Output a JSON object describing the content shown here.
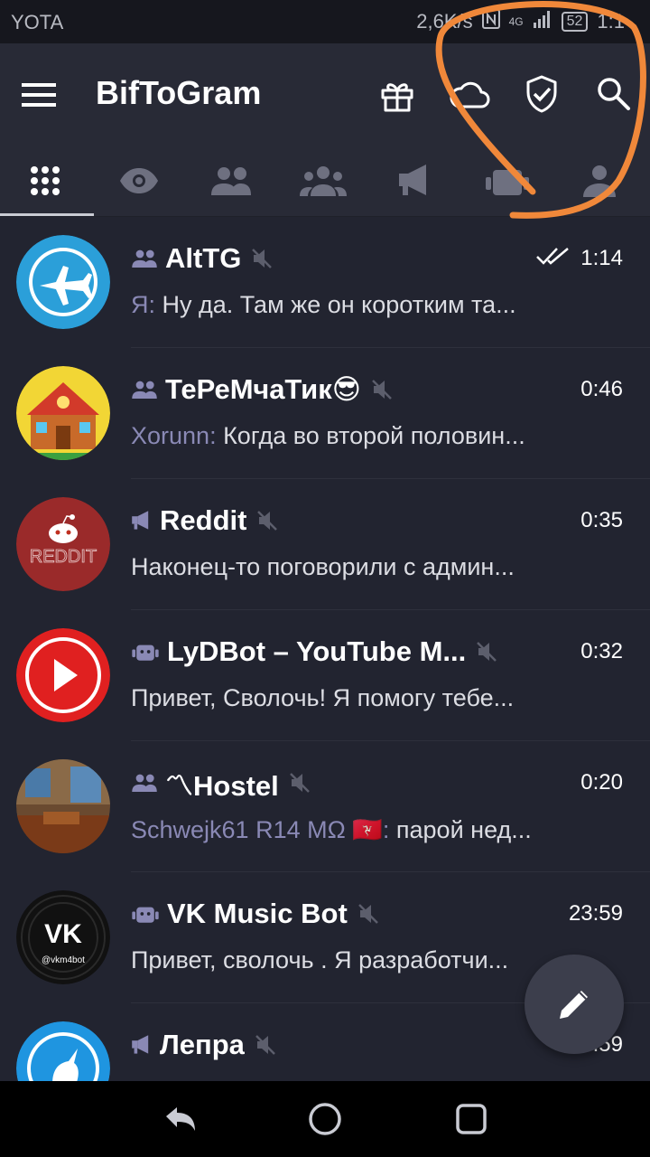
{
  "status_bar": {
    "carrier": "YOTA",
    "speed": "2,6K/s",
    "network": "4G",
    "battery": "52",
    "time": "1:1"
  },
  "app_bar": {
    "title": "BifToGram",
    "icons": [
      "menu-icon",
      "gift-icon",
      "cloud-icon",
      "shield-check-icon",
      "search-icon"
    ]
  },
  "tabs": [
    {
      "icon": "grid-icon",
      "active": true
    },
    {
      "icon": "eye-icon",
      "active": false
    },
    {
      "icon": "group-icon",
      "active": false
    },
    {
      "icon": "people-icon",
      "active": false
    },
    {
      "icon": "megaphone-icon",
      "active": false
    },
    {
      "icon": "bot-icon",
      "active": false
    },
    {
      "icon": "person-icon",
      "active": false
    }
  ],
  "chats": [
    {
      "name": "AltTG",
      "type": "group",
      "muted": true,
      "time": "1:14",
      "read": true,
      "sender": "Я:",
      "message": " Ну да. Там же он коротким та...",
      "avatar_color": "#2b9fd9"
    },
    {
      "name": "ТеРеМчаТик😎",
      "type": "group",
      "muted": true,
      "time": "0:46",
      "sender": "Xorunn:",
      "message": " Когда во второй половин...",
      "avatar_color": "#f0c020"
    },
    {
      "name": "Reddit",
      "type": "channel",
      "muted": true,
      "time": "0:35",
      "sender": "",
      "message": "Наконец-то поговорили с админ...",
      "avatar_color": "#9a2a2a"
    },
    {
      "name": "LyDBot – YouTube M...",
      "type": "bot",
      "muted": true,
      "time": "0:32",
      "sender": "",
      "message": "Привет, Сволочь! Я помогу тебе...",
      "avatar_color": "#e02020"
    },
    {
      "name": "〽Hostel",
      "type": "group",
      "muted": true,
      "time": "0:20",
      "sender": "Schwejk61 R14 MΩ 🇮🇲:",
      "message": " парой нед...",
      "avatar_color": "#6a4a30"
    },
    {
      "name": "VK Music Bot",
      "type": "bot",
      "muted": true,
      "time": "23:59",
      "sender": "",
      "message": "Привет, сволочь . Я разработчи...",
      "avatar_color": "#111111",
      "avatar_caption": "@vkm4bot"
    },
    {
      "name": "Лепра",
      "type": "channel",
      "muted": true,
      "time": "23:59",
      "sender": "",
      "message": "",
      "avatar_color": "#1f95e0"
    }
  ],
  "fab": {
    "icon": "pencil-icon"
  },
  "nav_bar": {
    "icons": [
      "back-icon",
      "home-icon",
      "recents-icon"
    ]
  },
  "colors": {
    "background": "#222430",
    "app_bar": "#282a36",
    "sender": "#8a89b5",
    "annotation": "#f0883a"
  }
}
